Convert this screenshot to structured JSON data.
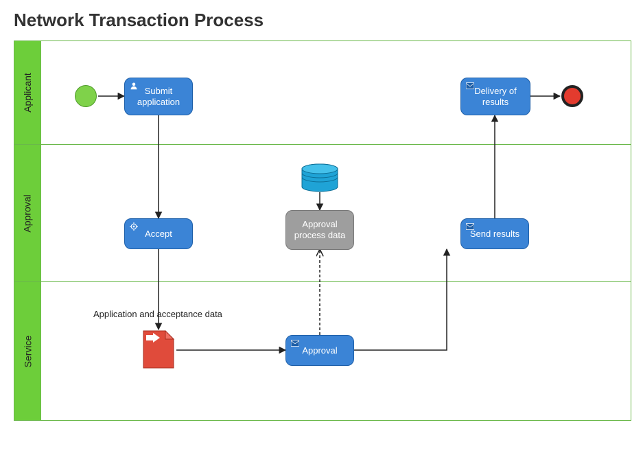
{
  "title": "Network Transaction Process",
  "lanes": {
    "applicant": "Applicant",
    "approval": "Approval",
    "service": "Service"
  },
  "nodes": {
    "submit": "Submit application",
    "accept": "Accept",
    "approval_data": "Approval process data",
    "approval_task": "Approval",
    "send_results": "Send results",
    "delivery": "Delivery of results"
  },
  "labels": {
    "app_accept_data": "Application and acceptance data"
  },
  "icons": {
    "user": "user-icon",
    "gear": "gear-icon",
    "envelope": "envelope-icon",
    "datastore": "data-store-icon",
    "document_send": "document-send-icon"
  },
  "colors": {
    "lane_header": "#6dce3a",
    "lane_border": "#6ab84a",
    "task_blue": "#3b84d6",
    "task_gray": "#9e9e9e",
    "start": "#7fd24a",
    "end": "#e33b2e",
    "datastore": "#1fa3d6",
    "document": "#e04b3b"
  }
}
